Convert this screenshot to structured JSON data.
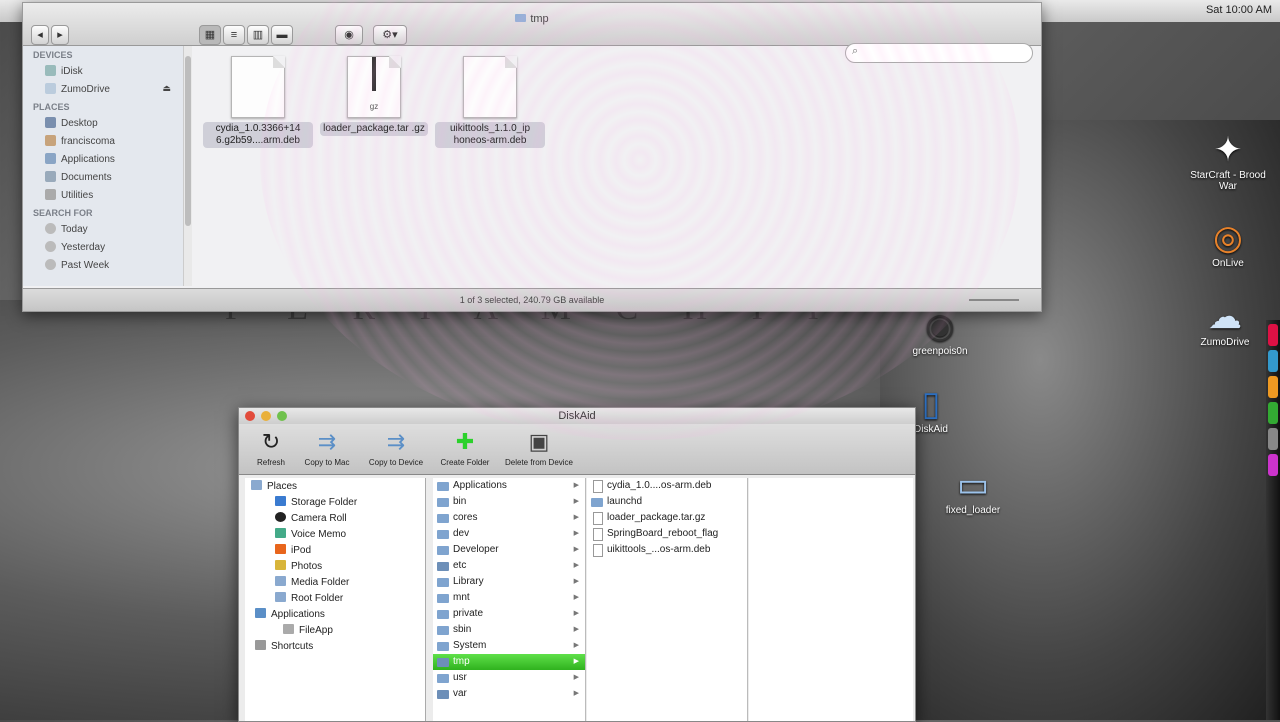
{
  "menubar": {
    "clock": "Sat 10:00 AM"
  },
  "desktop": {
    "backdrop_text": "P E R I A M C H I I",
    "icons": [
      {
        "label": "StarCraft - Brood War",
        "glyph": "✦"
      },
      {
        "label": "OnLive",
        "glyph": "◎"
      },
      {
        "label": "ZumoDrive",
        "glyph": "☁"
      },
      {
        "label": "greenpois0n",
        "glyph": "◉"
      },
      {
        "label": "DiskAid",
        "glyph": "▯"
      },
      {
        "label": "fixed_loader",
        "glyph": "▭"
      }
    ]
  },
  "finder": {
    "title": "tmp",
    "toolbar": {
      "back": "◂",
      "forward": "▸",
      "view_icon": "▦",
      "view_list": "≡",
      "view_column": "▥",
      "view_flow": "▬",
      "quicklook": "◉",
      "action": "⚙▾"
    },
    "search": {
      "icon": "⌕",
      "placeholder": ""
    },
    "sidebar": {
      "devices_header": "DEVICES",
      "devices": [
        {
          "label": "iDisk"
        },
        {
          "label": "ZumoDrive",
          "eject": "⏏"
        }
      ],
      "places_header": "PLACES",
      "places": [
        {
          "label": "Desktop"
        },
        {
          "label": "franciscoma"
        },
        {
          "label": "Applications"
        },
        {
          "label": "Documents"
        },
        {
          "label": "Utilities"
        }
      ],
      "search_header": "SEARCH FOR",
      "searches": [
        {
          "label": "Today"
        },
        {
          "label": "Yesterday"
        },
        {
          "label": "Past Week"
        }
      ]
    },
    "files": [
      {
        "name": "cydia_1.0.3366+14 6.g2b59....arm.deb"
      },
      {
        "name": "loader_package.tar .gz",
        "badge": "gz"
      },
      {
        "name": "uikittools_1.1.0_ip honeos-arm.deb"
      }
    ],
    "status": "1 of 3 selected, 240.79 GB available"
  },
  "diskaid": {
    "title": "DiskAid",
    "toolbar": [
      {
        "label": "Refresh",
        "glyph": "↻"
      },
      {
        "label": "Copy to Mac",
        "glyph": "⇉"
      },
      {
        "label": "Copy to Device",
        "glyph": "⇉"
      },
      {
        "label": "Create Folder",
        "glyph": "✚"
      },
      {
        "label": "Delete from Device",
        "glyph": "▣"
      }
    ],
    "places": {
      "header": "Places",
      "items": [
        "Storage Folder",
        "Camera Roll",
        "Voice Memo",
        "iPod",
        "Photos",
        "Media Folder",
        "Root Folder"
      ],
      "applications_header": "Applications",
      "applications": [
        "FileApp"
      ],
      "shortcuts_header": "Shortcuts"
    },
    "root_column": [
      "Applications",
      "bin",
      "cores",
      "dev",
      "Developer",
      "etc",
      "Library",
      "mnt",
      "private",
      "sbin",
      "System",
      "tmp",
      "usr",
      "var"
    ],
    "tmp_column": [
      "cydia_1.0....os-arm.deb",
      "launchd",
      "loader_package.tar.gz",
      "SpringBoard_reboot_flag",
      "uikittools_...os-arm.deb"
    ]
  }
}
